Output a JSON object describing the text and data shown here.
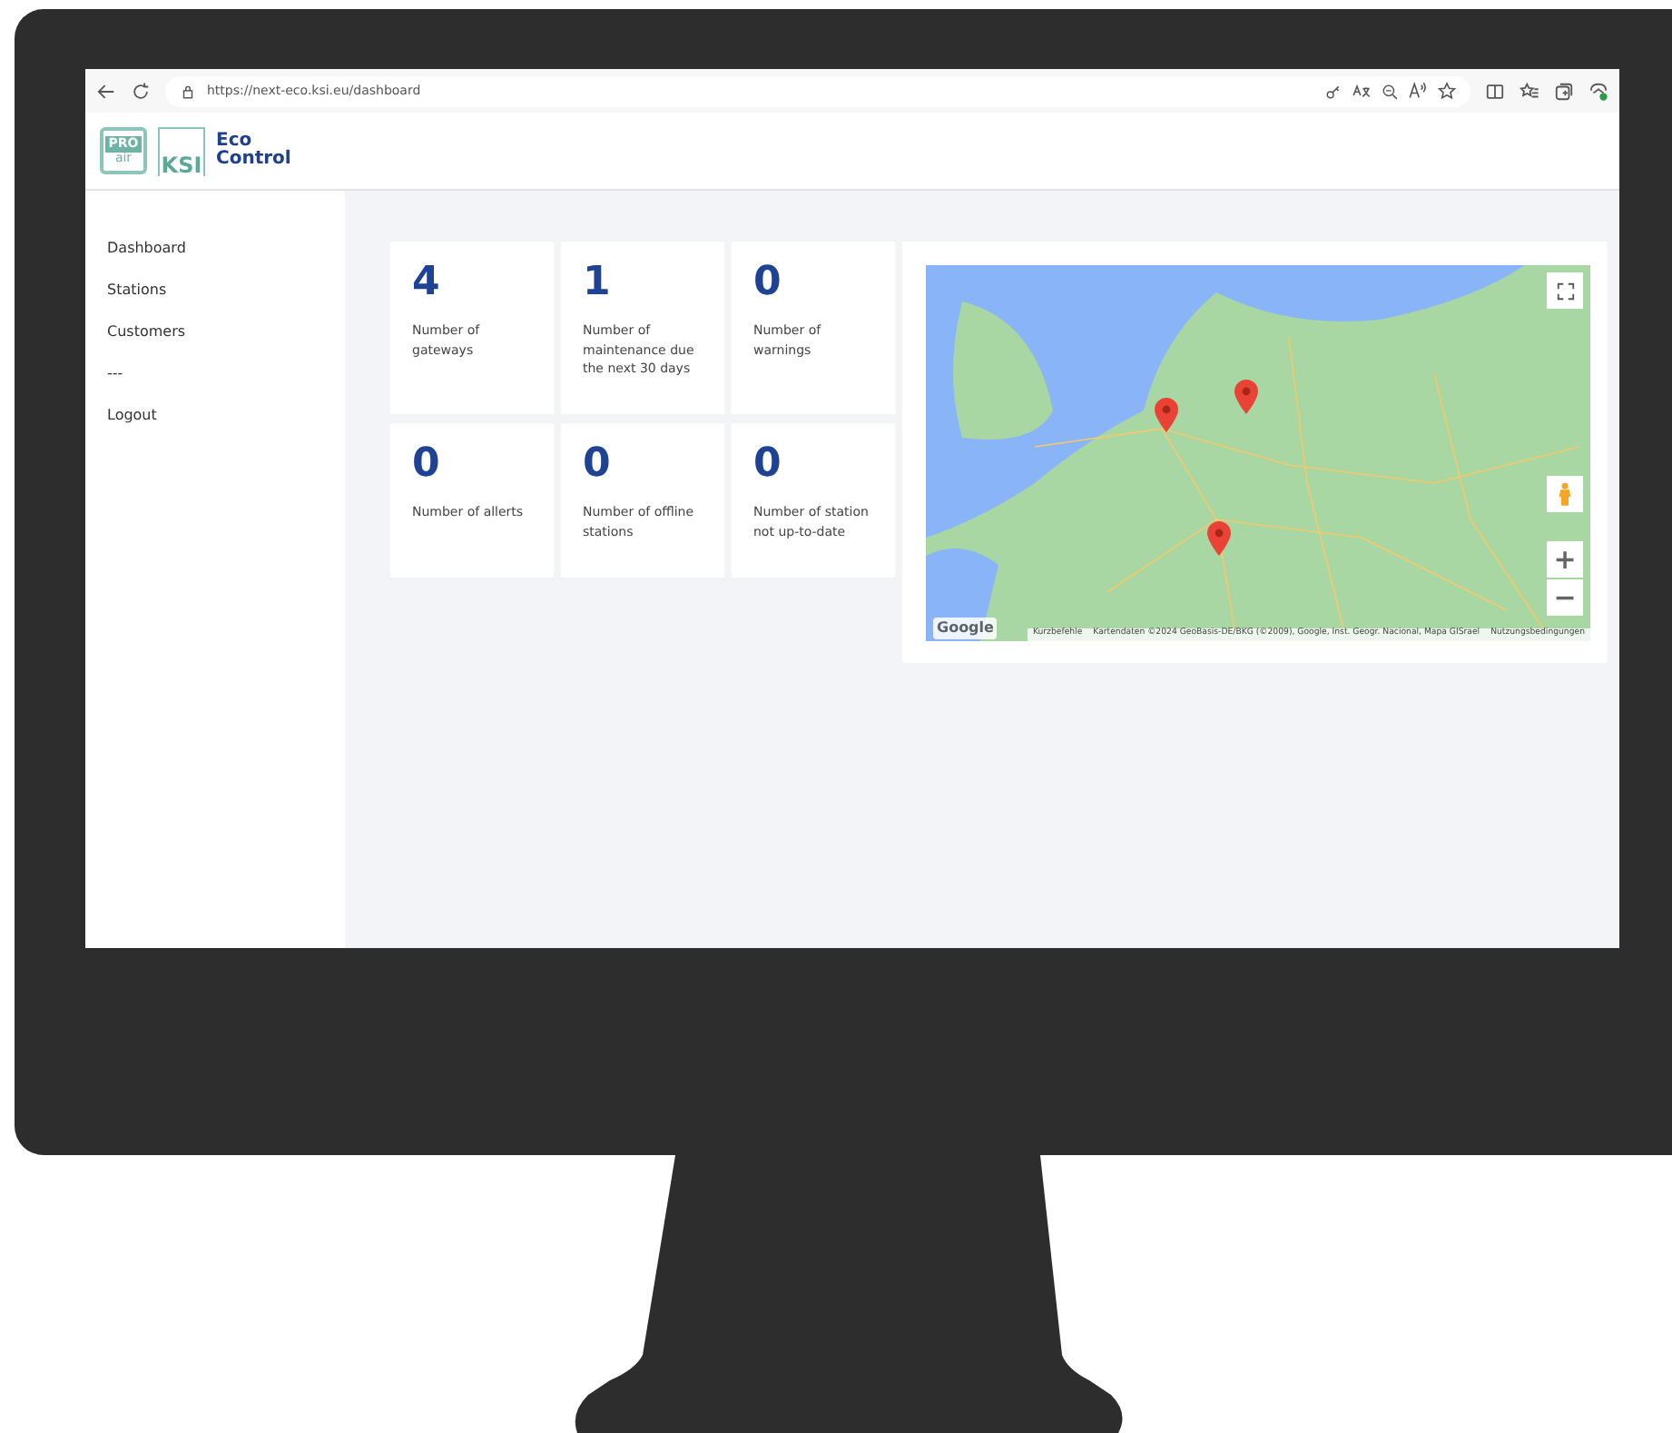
{
  "browser": {
    "url": "https://next-eco.ksi.eu/dashboard"
  },
  "logo": {
    "badge_top": "PRO",
    "badge_bottom": "air",
    "ksi": "KSI",
    "title_lines": [
      "Eco",
      "Control"
    ]
  },
  "sidebar": {
    "items": [
      {
        "label": "Dashboard"
      },
      {
        "label": "Stations"
      },
      {
        "label": "Customers"
      },
      {
        "label": "---"
      },
      {
        "label": "Logout"
      }
    ]
  },
  "stats": [
    {
      "value": "4",
      "label": "Number of gateways"
    },
    {
      "value": "1",
      "label": "Number of maintenance due the next 30 days"
    },
    {
      "value": "0",
      "label": "Number of warnings"
    },
    {
      "value": "0",
      "label": "Number of allerts"
    },
    {
      "value": "0",
      "label": "Number of offline stations"
    },
    {
      "value": "0",
      "label": "Number of station not up-to-date"
    }
  ],
  "map": {
    "logo": "Google",
    "zoom_in": "+",
    "zoom_out": "−",
    "attribution": [
      "Kurzbefehle",
      "Kartendaten ©2024 GeoBasis-DE/BKG (©2009), Google, Inst. Geogr. Nacional, Mapa GISrael",
      "Nutzungsbedingungen"
    ]
  }
}
